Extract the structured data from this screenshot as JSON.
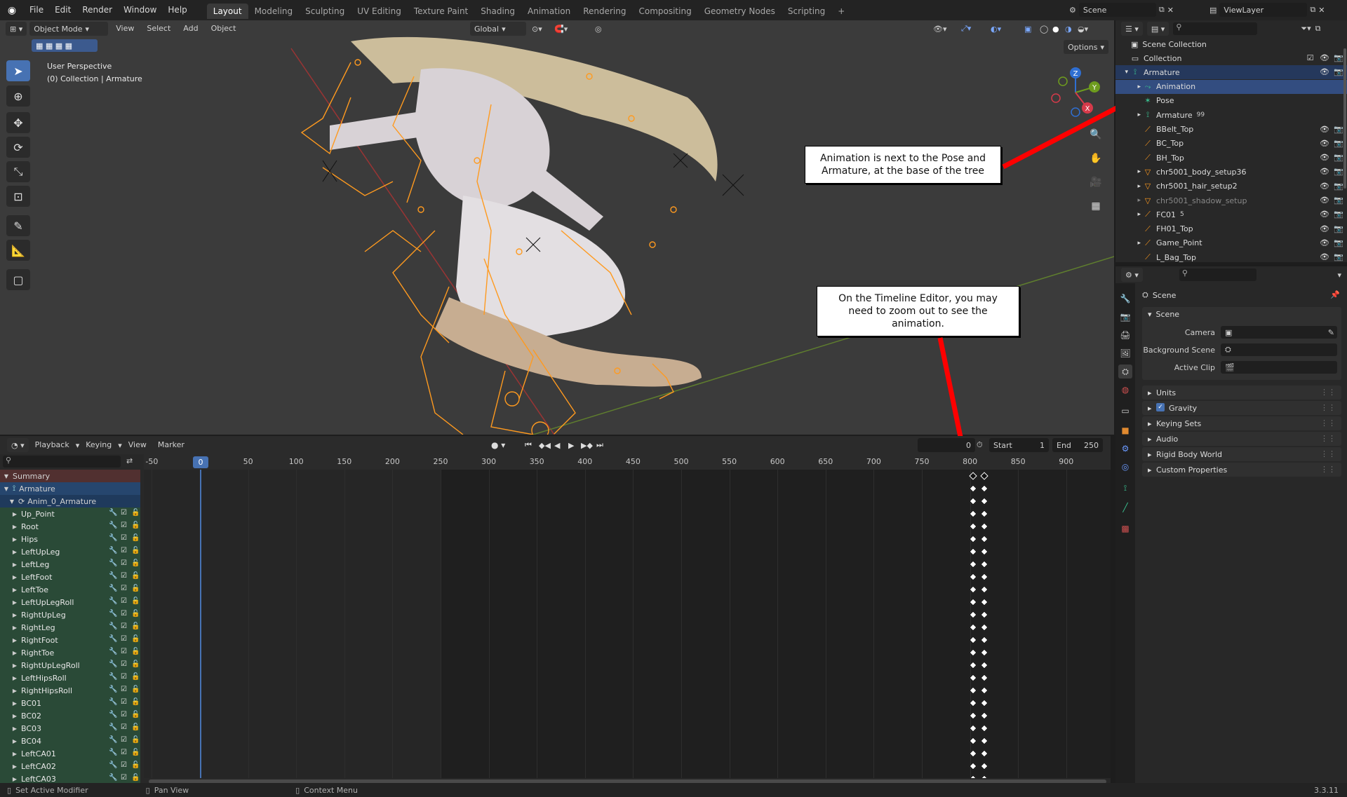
{
  "topbar": {
    "menus": [
      "File",
      "Edit",
      "Render",
      "Window",
      "Help"
    ],
    "workspaces": [
      "Layout",
      "Modeling",
      "Sculpting",
      "UV Editing",
      "Texture Paint",
      "Shading",
      "Animation",
      "Rendering",
      "Compositing",
      "Geometry Nodes",
      "Scripting"
    ],
    "active_workspace": "Layout",
    "add_tab": "+",
    "scene": "Scene",
    "view_layer": "ViewLayer"
  },
  "viewport": {
    "mode": "Object Mode",
    "menus": [
      "View",
      "Select",
      "Add",
      "Object"
    ],
    "transform": "Global",
    "options": "Options",
    "view_name": "User Perspective",
    "view_context": "(0) Collection | Armature",
    "gizmo": {
      "x": "X",
      "y": "Y",
      "z": "Z"
    }
  },
  "callouts": {
    "outliner": "Animation is next to the Pose and Armature, at the base of the tree",
    "timeline": "On the Timeline Editor, you may need to zoom out to see the animation."
  },
  "timeline": {
    "menus": [
      "Playback",
      "Keying",
      "View",
      "Marker"
    ],
    "current_frame": "0",
    "start_label": "Start",
    "start": "1",
    "end_label": "End",
    "end": "250",
    "ruler": [
      "-50",
      "0",
      "50",
      "100",
      "150",
      "200",
      "250",
      "300",
      "350",
      "400",
      "450",
      "500",
      "550",
      "600",
      "650",
      "700",
      "750",
      "800",
      "850",
      "900"
    ],
    "playhead": "0",
    "summary": "Summary",
    "object": "Armature",
    "action": "Anim_0_Armature",
    "channels": [
      "Up_Point",
      "Root",
      "Hips",
      "LeftUpLeg",
      "LeftLeg",
      "LeftFoot",
      "LeftToe",
      "LeftUpLegRoll",
      "RightUpLeg",
      "RightLeg",
      "RightFoot",
      "RightToe",
      "RightUpLegRoll",
      "LeftHipsRoll",
      "RightHipsRoll",
      "BC01",
      "BC02",
      "BC03",
      "BC04",
      "LeftCA01",
      "LeftCA02",
      "LeftCA03"
    ]
  },
  "outliner": {
    "root": "Scene Collection",
    "items": [
      {
        "label": "Collection",
        "depth": 1,
        "icon": "collection-icon"
      },
      {
        "label": "Armature",
        "depth": 1,
        "icon": "armature-icon",
        "state": "selected"
      },
      {
        "label": "Animation",
        "depth": 2,
        "icon": "animation-icon",
        "state": "active"
      },
      {
        "label": "Pose",
        "depth": 2,
        "icon": "pose-icon"
      },
      {
        "label": "Armature",
        "depth": 2,
        "icon": "armature-data-icon",
        "badge": "99"
      },
      {
        "label": "BBelt_Top",
        "depth": 2,
        "icon": "bone-icon"
      },
      {
        "label": "BC_Top",
        "depth": 2,
        "icon": "bone-icon"
      },
      {
        "label": "BH_Top",
        "depth": 2,
        "icon": "bone-icon"
      },
      {
        "label": "chr5001_body_setup36",
        "depth": 2,
        "icon": "mesh-icon"
      },
      {
        "label": "chr5001_hair_setup2",
        "depth": 2,
        "icon": "mesh-icon"
      },
      {
        "label": "chr5001_shadow_setup",
        "depth": 2,
        "icon": "mesh-icon",
        "state": "dim"
      },
      {
        "label": "FC01",
        "depth": 2,
        "icon": "bone-icon",
        "badge": "5"
      },
      {
        "label": "FH01_Top",
        "depth": 2,
        "icon": "bone-icon"
      },
      {
        "label": "Game_Point",
        "depth": 2,
        "icon": "bone-icon"
      },
      {
        "label": "L_Bag_Top",
        "depth": 2,
        "icon": "bone-icon"
      }
    ]
  },
  "properties": {
    "context": "Scene",
    "panel_title": "Scene",
    "rows": [
      {
        "label": "Camera"
      },
      {
        "label": "Background Scene"
      },
      {
        "label": "Active Clip"
      }
    ],
    "subpanels": [
      "Units",
      "Gravity",
      "Keying Sets",
      "Audio",
      "Rigid Body World",
      "Custom Properties"
    ]
  },
  "statusbar": {
    "left": "Set Active Modifier",
    "middle": "Pan View",
    "right": "Context Menu",
    "version": "3.3.11"
  },
  "colors": {
    "accent": "#4772b3",
    "bone": "#ff9a1f",
    "arrow": "#ff0000",
    "channel": "#2a4a37"
  }
}
